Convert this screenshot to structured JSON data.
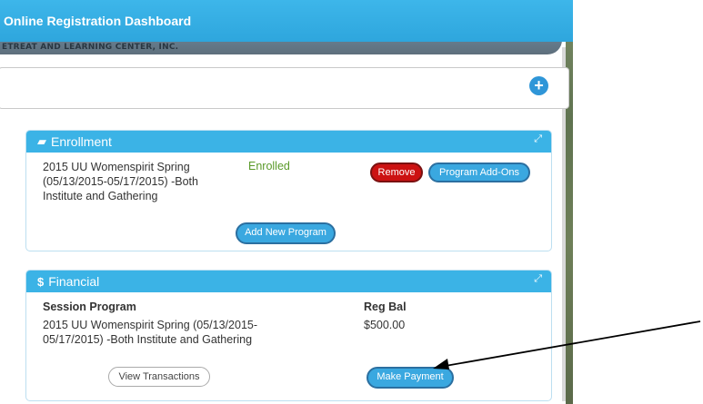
{
  "header": {
    "title": "Online Registration Dashboard",
    "subtitle": "ETREAT AND LEARNING CENTER, INC."
  },
  "search": {
    "add_icon": "plus-circle-icon"
  },
  "enrollment": {
    "title": "Enrollment",
    "program": "2015 UU Womenspirit Spring (05/13/2015-05/17/2015) -Both Institute and Gathering",
    "program_lines": [
      "2015 UU Womenspirit Spring",
      "(05/13/2015-05/17/2015) -Both",
      "Institute and Gathering"
    ],
    "status": "Enrolled",
    "remove_label": "Remove",
    "addons_label": "Program Add-Ons",
    "add_program_label": "Add New Program"
  },
  "financial": {
    "title": "Financial",
    "col_session": "Session Program",
    "col_balance": "Reg Bal",
    "program_lines": [
      "2015 UU Womenspirit Spring (05/13/2015-",
      "05/17/2015) -Both Institute and Gathering"
    ],
    "balance": "$500.00",
    "view_transactions_label": "View Transactions",
    "make_payment_label": "Make Payment"
  },
  "colors": {
    "header": "#3db6ea",
    "remove": "#cc1212",
    "enrolled": "#5a9a2a"
  }
}
